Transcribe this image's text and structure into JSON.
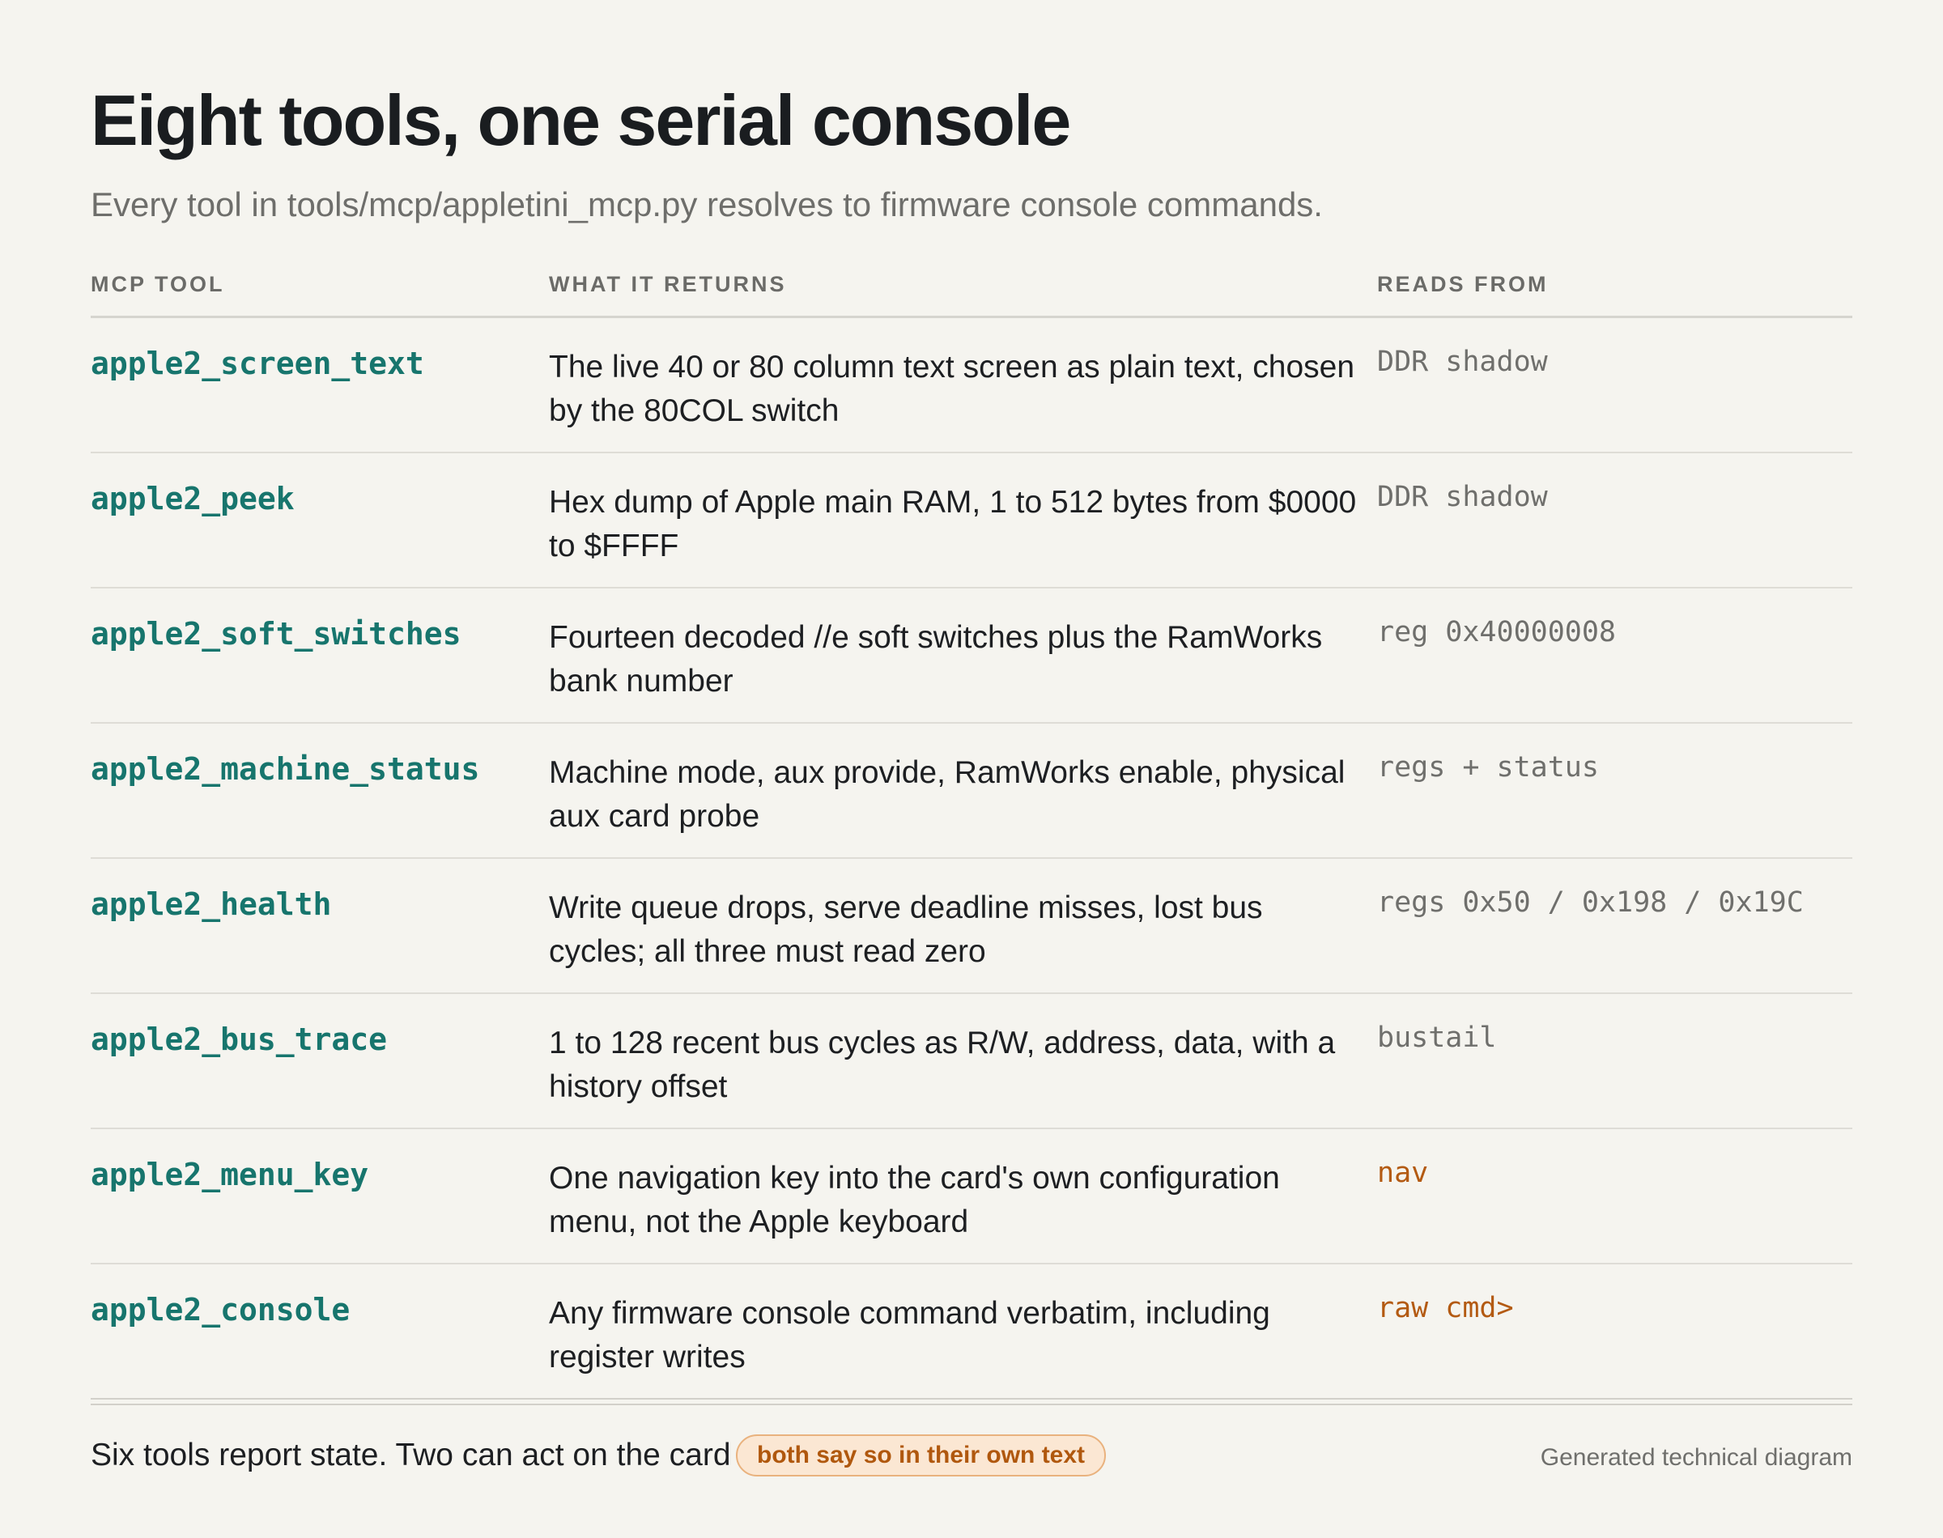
{
  "header": {
    "title": "Eight tools, one serial console",
    "subtitle": "Every tool in tools/mcp/appletini_mcp.py resolves to firmware console commands."
  },
  "table": {
    "columns": [
      "MCP TOOL",
      "WHAT IT RETURNS",
      "READS FROM"
    ],
    "rows": [
      {
        "tool": "apple2_screen_text",
        "returns": "The live 40 or 80 column text screen as plain text, chosen by the 80COL switch",
        "source": "DDR shadow",
        "acts_on_card": false
      },
      {
        "tool": "apple2_peek",
        "returns": "Hex dump of Apple main RAM, 1 to 512 bytes from $0000 to $FFFF",
        "source": "DDR shadow",
        "acts_on_card": false
      },
      {
        "tool": "apple2_soft_switches",
        "returns": "Fourteen decoded //e soft switches plus the RamWorks bank number",
        "source": "reg 0x40000008",
        "acts_on_card": false
      },
      {
        "tool": "apple2_machine_status",
        "returns": "Machine mode, aux provide, RamWorks enable, physical aux card probe",
        "source": "regs + status",
        "acts_on_card": false
      },
      {
        "tool": "apple2_health",
        "returns": "Write queue drops, serve deadline misses, lost bus cycles; all three must read zero",
        "source": "regs 0x50 / 0x198 / 0x19C",
        "acts_on_card": false
      },
      {
        "tool": "apple2_bus_trace",
        "returns": "1 to 128 recent bus cycles as R/W, address, data, with a history offset",
        "source": "bustail",
        "acts_on_card": false
      },
      {
        "tool": "apple2_menu_key",
        "returns": "One navigation key into the card's own configuration menu, not the Apple keyboard",
        "source": "nav",
        "acts_on_card": true
      },
      {
        "tool": "apple2_console",
        "returns": "Any firmware console command verbatim, including register writes",
        "source": "raw cmd>",
        "acts_on_card": true
      }
    ]
  },
  "footer": {
    "note": "Six tools report state. Two can act on the card",
    "badge": "both say so in their own text",
    "credit": "Generated technical diagram"
  },
  "colors": {
    "background": "#f5f4ef",
    "tool_name": "#17756d",
    "source_read": "#6f6f6c",
    "source_act": "#b35a12",
    "badge_fill": "#fbe7d3",
    "badge_border": "#e9b27e"
  }
}
